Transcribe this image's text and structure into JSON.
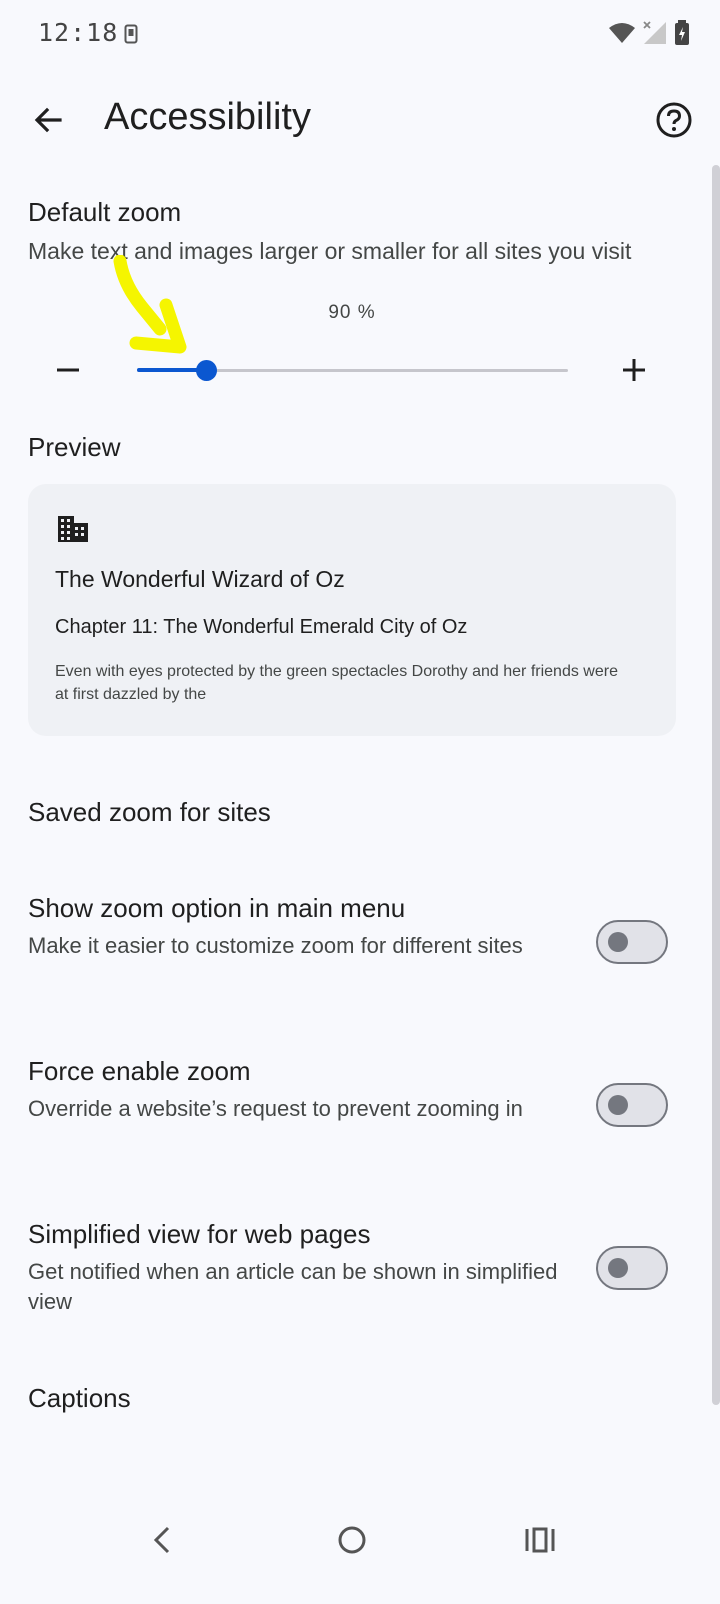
{
  "status_bar": {
    "time": "12:18",
    "icons": [
      "phone-icon",
      "wifi-icon",
      "signal-icon",
      "battery-icon"
    ]
  },
  "app_bar": {
    "title": "Accessibility",
    "back_icon": "arrow-back-icon",
    "help_icon": "help-icon"
  },
  "default_zoom": {
    "title": "Default zoom",
    "description": "Make text and images larger or smaller for all sites you visit",
    "value_label": "90 %",
    "slider_fraction": 0.16,
    "accent_color": "#0b57d0",
    "annotation_color": "#f5f500"
  },
  "preview": {
    "heading": "Preview",
    "icon": "building-icon",
    "book_title": "The Wonderful Wizard of Oz",
    "chapter": "Chapter 11: The Wonderful Emerald City of Oz",
    "body": "Even with eyes protected by the green spectacles Dorothy and her friends were at first dazzled by the"
  },
  "saved_zoom": {
    "label": "Saved zoom for sites"
  },
  "settings": [
    {
      "title": "Show zoom option in main menu",
      "description": "Make it easier to customize zoom for different sites",
      "enabled": false
    },
    {
      "title": "Force enable zoom",
      "description": "Override a website’s request to prevent zooming in",
      "enabled": false
    },
    {
      "title": "Simplified view for web pages",
      "description": "Get notified when an article can be shown in simplified view",
      "enabled": false
    }
  ],
  "captions": {
    "label": "Captions"
  },
  "nav_bar": {
    "icons": [
      "nav-back-icon",
      "nav-home-icon",
      "nav-recents-icon"
    ]
  }
}
